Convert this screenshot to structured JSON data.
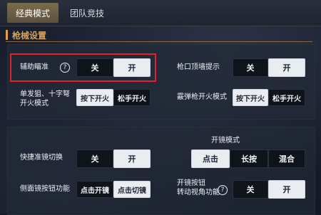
{
  "tabs": [
    {
      "label": "经典模式",
      "active": true
    },
    {
      "label": "团队竞技",
      "active": false
    }
  ],
  "section": {
    "title": "枪械设置"
  },
  "panel1": {
    "assist_aim": {
      "label": "辅助瞄准",
      "off": "关",
      "on": "开",
      "selected": "开"
    },
    "muzzle_hint": {
      "label": "枪口顶墙提示",
      "off": "关",
      "on": "开",
      "selected": "开"
    },
    "sniper_fire": {
      "label_line1": "单发狙、十字弩",
      "label_line2": "开火模式",
      "press": "按下开火",
      "release": "松手开火",
      "selected": "按下开火"
    },
    "shotgun_fire": {
      "label": "霰弹枪开火模式",
      "press": "按下开火",
      "release": "松手开火",
      "selected": "按下开火"
    }
  },
  "panel2": {
    "quick_scope": {
      "label": "快捷准镜切换",
      "off": "关",
      "on": "开",
      "selected": "开"
    },
    "scope_mode": {
      "label": "开镜模式",
      "tap": "点击",
      "hold": "长按",
      "mix": "混合",
      "selected": "点击"
    },
    "side_scope": {
      "label": "侧面镜按钮功能",
      "open": "点击开镜",
      "switch": "点击切镜",
      "selected": "点击切镜"
    },
    "scope_view": {
      "label_line1": "开镜按钮",
      "label_line2": "转动视角功能",
      "off": "关",
      "on": "开",
      "selected": "开"
    }
  }
}
